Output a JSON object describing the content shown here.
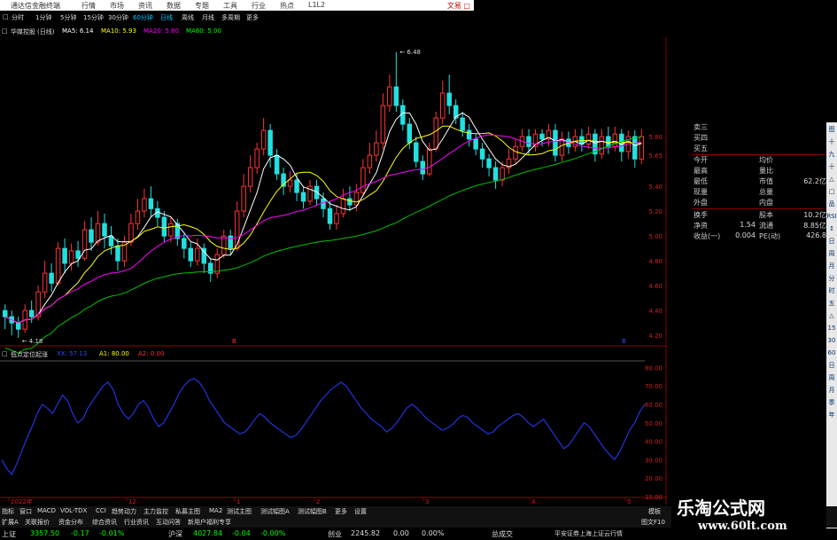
{
  "window": {
    "title": "通达信金融终端",
    "right_label": "文易 □"
  },
  "menus": [
    "行情",
    "市场",
    "资讯",
    "数据",
    "专题",
    "工具",
    "行业",
    "热点",
    "L1L2"
  ],
  "periods": [
    "分时",
    "1分钟",
    "5分钟",
    "15分钟",
    "30分钟",
    "60分钟",
    "日线",
    "周线",
    "月线",
    "多周期",
    "更多"
  ],
  "chart_header": {
    "stock": "华媒控股",
    "period": "(日线)",
    "ma": [
      {
        "label": "MA5: 6.14",
        "color": "#ffffff"
      },
      {
        "label": "MA10: 5.93",
        "color": "#ffff00"
      },
      {
        "label": "MA20: 5.80",
        "color": "#ff00ff"
      },
      {
        "label": "MA60: 5.00",
        "color": "#00ff00"
      }
    ]
  },
  "indicator_header": {
    "name": "低点定位起涨",
    "items": [
      {
        "label": "XX: 57.13",
        "color": "#3344ff"
      },
      {
        "label": "A1: 80.00",
        "color": "#ffff00"
      },
      {
        "label": "A2: 0.00",
        "color": "#ff3333"
      }
    ]
  },
  "chart_data": {
    "type": "candlestick",
    "price_axis": {
      "ticks": [
        "5.80",
        "5.65",
        "5.40",
        "5.20",
        "5.00",
        "4.80",
        "4.60",
        "4.40",
        "4.20"
      ],
      "min": 4.13,
      "max": 6.6
    },
    "indicator_axis": {
      "ticks": [
        "80.00",
        "70.00",
        "60.00",
        "50.00",
        "40.00",
        "30.00",
        "20.00",
        "10.00"
      ],
      "min": 10,
      "max": 85
    },
    "annotations": [
      {
        "text": "6.48",
        "value": 6.48
      },
      {
        "text": "4.18",
        "value": 4.18
      }
    ],
    "x_labels": [
      "2022年",
      "12",
      "1",
      "2",
      "3",
      "4",
      "5"
    ],
    "candles": [
      [
        4.4,
        4.35,
        4.45,
        4.25
      ],
      [
        4.35,
        4.3,
        4.4,
        4.2
      ],
      [
        4.3,
        4.25,
        4.35,
        4.18
      ],
      [
        4.25,
        4.4,
        4.45,
        4.22
      ],
      [
        4.4,
        4.35,
        4.48,
        4.3
      ],
      [
        4.35,
        4.55,
        4.6,
        4.32
      ],
      [
        4.55,
        4.7,
        4.8,
        4.5
      ],
      [
        4.7,
        4.62,
        4.78,
        4.55
      ],
      [
        4.62,
        4.9,
        4.95,
        4.6
      ],
      [
        4.9,
        4.78,
        4.98,
        4.7
      ],
      [
        4.78,
        4.88,
        4.94,
        4.72
      ],
      [
        4.88,
        4.82,
        4.96,
        4.75
      ],
      [
        4.82,
        5.05,
        5.12,
        4.8
      ],
      [
        5.05,
        4.95,
        5.15,
        4.88
      ],
      [
        4.95,
        5.1,
        5.2,
        4.92
      ],
      [
        5.1,
        5.0,
        5.18,
        4.9
      ],
      [
        5.0,
        4.92,
        5.08,
        4.85
      ],
      [
        4.92,
        4.8,
        4.98,
        4.72
      ],
      [
        4.8,
        4.95,
        5.0,
        4.75
      ],
      [
        4.95,
        5.1,
        5.18,
        4.92
      ],
      [
        5.1,
        5.2,
        5.3,
        5.05
      ],
      [
        5.2,
        5.3,
        5.38,
        5.15
      ],
      [
        5.3,
        5.22,
        5.4,
        5.15
      ],
      [
        5.22,
        5.15,
        5.28,
        5.08
      ],
      [
        5.15,
        5.0,
        5.2,
        4.95
      ],
      [
        5.0,
        5.1,
        5.15,
        4.95
      ],
      [
        5.1,
        4.98,
        5.14,
        4.92
      ],
      [
        4.98,
        4.9,
        5.02,
        4.82
      ],
      [
        4.9,
        4.8,
        4.95,
        4.75
      ],
      [
        4.8,
        4.9,
        4.98,
        4.76
      ],
      [
        4.9,
        4.78,
        4.94,
        4.7
      ],
      [
        4.78,
        4.7,
        4.82,
        4.63
      ],
      [
        4.7,
        4.85,
        4.9,
        4.66
      ],
      [
        4.85,
        5.0,
        5.05,
        4.82
      ],
      [
        5.0,
        4.9,
        5.05,
        4.85
      ],
      [
        4.9,
        5.2,
        5.28,
        4.88
      ],
      [
        5.2,
        5.4,
        5.5,
        5.15
      ],
      [
        5.4,
        5.55,
        5.65,
        5.35
      ],
      [
        5.55,
        5.7,
        5.75,
        5.5
      ],
      [
        5.7,
        5.85,
        5.95,
        5.65
      ],
      [
        5.85,
        5.65,
        5.9,
        5.55
      ],
      [
        5.65,
        5.5,
        5.7,
        5.45
      ],
      [
        5.5,
        5.4,
        5.55,
        5.33
      ],
      [
        5.4,
        5.45,
        5.52,
        5.35
      ],
      [
        5.45,
        5.35,
        5.5,
        5.28
      ],
      [
        5.35,
        5.28,
        5.4,
        5.22
      ],
      [
        5.28,
        5.4,
        5.45,
        5.25
      ],
      [
        5.4,
        5.3,
        5.45,
        5.25
      ],
      [
        5.3,
        5.22,
        5.35,
        5.15
      ],
      [
        5.22,
        5.1,
        5.28,
        5.05
      ],
      [
        5.1,
        5.18,
        5.25,
        5.05
      ],
      [
        5.18,
        5.3,
        5.38,
        5.15
      ],
      [
        5.3,
        5.25,
        5.4,
        5.2
      ],
      [
        5.25,
        5.35,
        5.42,
        5.2
      ],
      [
        5.35,
        5.55,
        5.62,
        5.32
      ],
      [
        5.55,
        5.65,
        5.75,
        5.5
      ],
      [
        5.65,
        5.75,
        5.85,
        5.6
      ],
      [
        5.75,
        6.05,
        6.15,
        5.7
      ],
      [
        6.05,
        6.2,
        6.3,
        6.0
      ],
      [
        6.2,
        6.05,
        6.48,
        6.0
      ],
      [
        6.05,
        5.9,
        6.1,
        5.85
      ],
      [
        5.9,
        5.75,
        5.95,
        5.7
      ],
      [
        5.75,
        5.6,
        5.8,
        5.55
      ],
      [
        5.6,
        5.5,
        5.65,
        5.45
      ],
      [
        5.5,
        5.7,
        5.75,
        5.48
      ],
      [
        5.7,
        5.95,
        6.0,
        5.68
      ],
      [
        5.95,
        6.15,
        6.25,
        5.9
      ],
      [
        6.15,
        6.05,
        6.3,
        5.98
      ],
      [
        6.05,
        5.95,
        6.1,
        5.9
      ],
      [
        5.95,
        5.85,
        6.0,
        5.8
      ],
      [
        5.85,
        5.78,
        5.9,
        5.72
      ],
      [
        5.78,
        5.7,
        5.82,
        5.65
      ],
      [
        5.7,
        5.62,
        5.75,
        5.55
      ],
      [
        5.62,
        5.55,
        5.66,
        5.48
      ],
      [
        5.55,
        5.45,
        5.6,
        5.38
      ],
      [
        5.45,
        5.55,
        5.6,
        5.4
      ],
      [
        5.55,
        5.62,
        5.7,
        5.5
      ],
      [
        5.62,
        5.72,
        5.78,
        5.58
      ],
      [
        5.72,
        5.8,
        5.86,
        5.68
      ],
      [
        5.8,
        5.72,
        5.86,
        5.65
      ],
      [
        5.72,
        5.82,
        5.86,
        5.68
      ],
      [
        5.82,
        5.78,
        5.86,
        5.72
      ],
      [
        5.78,
        5.85,
        5.9,
        5.72
      ],
      [
        5.85,
        5.65,
        5.9,
        5.6
      ],
      [
        5.65,
        5.78,
        5.84,
        5.6
      ],
      [
        5.78,
        5.72,
        5.84,
        5.66
      ],
      [
        5.72,
        5.8,
        5.86,
        5.68
      ],
      [
        5.8,
        5.74,
        5.86,
        5.68
      ],
      [
        5.74,
        5.82,
        5.88,
        5.7
      ],
      [
        5.82,
        5.66,
        5.86,
        5.6
      ],
      [
        5.66,
        5.8,
        5.86,
        5.62
      ],
      [
        5.8,
        5.72,
        5.88,
        5.66
      ],
      [
        5.72,
        5.82,
        5.88,
        5.68
      ],
      [
        5.82,
        5.68,
        5.86,
        5.6
      ],
      [
        5.68,
        5.8,
        5.85,
        5.62
      ],
      [
        5.8,
        5.62,
        5.85,
        5.55
      ],
      [
        5.62,
        5.8,
        5.86,
        5.58
      ]
    ],
    "indicator_values": [
      30,
      25,
      22,
      28,
      35,
      42,
      48,
      55,
      60,
      58,
      55,
      60,
      65,
      62,
      55,
      50,
      52,
      58,
      62,
      66,
      70,
      72,
      68,
      60,
      55,
      52,
      55,
      60,
      62,
      58,
      52,
      48,
      50,
      55,
      60,
      66,
      70,
      73,
      74,
      72,
      68,
      62,
      58,
      54,
      50,
      48,
      46,
      44,
      45,
      48,
      52,
      55,
      53,
      50,
      48,
      46,
      44,
      42,
      43,
      46,
      50,
      54,
      58,
      62,
      65,
      68,
      70,
      72,
      70,
      66,
      62,
      58,
      55,
      52,
      50,
      48,
      45,
      47,
      50,
      54,
      58,
      60,
      58,
      55,
      52,
      50,
      48,
      46,
      47,
      49,
      52,
      54,
      53,
      50,
      48,
      46,
      44,
      45,
      48,
      50,
      52,
      54,
      55,
      53,
      50,
      48,
      50,
      52,
      48,
      44,
      40,
      36,
      38,
      42,
      46,
      50,
      48,
      44,
      40,
      36,
      33,
      30,
      34,
      40,
      46,
      50,
      56,
      60
    ],
    "signals": [
      {
        "text": "B",
        "color": "#ff3333"
      },
      {
        "text": "B",
        "color": "#3344ff"
      }
    ]
  },
  "quote_panel": {
    "rows": [
      {
        "label": "卖三"
      },
      {
        "label": "买四"
      },
      {
        "label": "买五"
      },
      {
        "l1": "今开",
        "l2": "均价",
        "v2": ""
      },
      {
        "l1": "最高",
        "l2": "量比",
        "v2": ""
      },
      {
        "l1": "最低",
        "l2": "市值",
        "v2": "62.2亿"
      },
      {
        "l1": "现量",
        "l2": "总量",
        "v2": ""
      },
      {
        "l1": "外盘",
        "l2": "内盘",
        "v2": ""
      },
      {
        "l1": "换手",
        "l2": "股本",
        "v2": "10.2亿"
      },
      {
        "l1": "净资",
        "v1": "1.54",
        "l2": "流通",
        "v2": "8.85亿"
      },
      {
        "l1": "收益(一)",
        "v1": "0.004",
        "l2": "PE(动)",
        "v2": "426.8"
      }
    ]
  },
  "tabs_row": [
    "指标",
    "窗口",
    "MACD",
    "VOL-TDX",
    "CCI",
    "趋势动力",
    "主力监控",
    "私募主图",
    "MA2",
    "测试主图",
    "测试幅图A",
    "测试幅图B",
    "更多",
    "设置"
  ],
  "tabs_right": "模板",
  "tabs_row2": [
    "扩展A",
    "关联报价",
    "资金分布",
    "综合资讯",
    "行业资讯",
    "互动问答",
    "新用户福利专享"
  ],
  "tabs_row2_right": "图文F10",
  "status": {
    "idx1_name": "上证",
    "idx1_val": "3357.50",
    "idx1_chg": "-0.17",
    "idx1_pct": "-0.01%",
    "idx2_name": "沪深",
    "idx2_val": "4027.84",
    "idx2_chg": "-0.04",
    "idx2_pct": "-0.00%",
    "idx3_name": "创业",
    "idx3_val": "2245.82",
    "idx3_chg": "0.00",
    "idx3_pct": "0.00%",
    "s4": "总成交",
    "s5": "平安证券上海上证云行情"
  },
  "toolbar_icons": [
    "图",
    "十",
    "九",
    "十",
    "△",
    "□",
    "品",
    "RSI",
    "↕",
    "日",
    "周",
    "月",
    "分",
    "时",
    "五",
    "△",
    "15",
    "30",
    "60",
    "日",
    "周",
    "月",
    "季",
    "年"
  ],
  "watermark": {
    "line1": "乐淘公式网",
    "line2": "www.60lt.com"
  },
  "colors": {
    "up": "#ff3333",
    "down": "#22e0e0",
    "ma5": "#ffffff",
    "ma10": "#ffff00",
    "ma20": "#ff00ff",
    "ma60": "#00c000",
    "indicator": "#2233dd",
    "grid": "#8b0000"
  }
}
